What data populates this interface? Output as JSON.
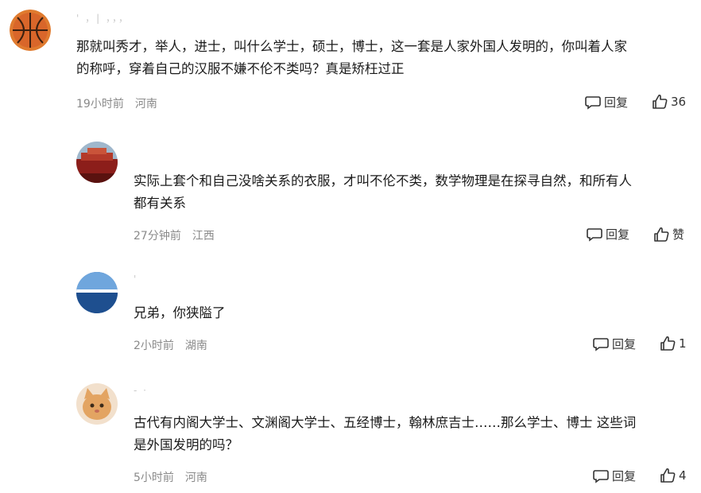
{
  "comments": [
    {
      "username": "' ，| ，，，",
      "text_lines": [
        "那就叫秀才，举人，进士，叫什么学士，硕士，博士，这一套是人家外国人发明的，你叫着人家",
        "的称呼，穿着自己的汉服不嫌不伦不类吗？真是矫枉过正"
      ],
      "time": "19小时前",
      "location": "河南",
      "reply_label": "回复",
      "like_label": "36",
      "avatar_icon": "basketball-icon"
    },
    {
      "username": "",
      "text_lines": [
        "实际上套个和自己没啥关系的衣服，才叫不伦不类，数学物理是在探寻自然，和所有人",
        "都有关系"
      ],
      "time": "27分钟前",
      "location": "江西",
      "reply_label": "回复",
      "like_label": "赞",
      "avatar_icon": "red-landscape-icon"
    },
    {
      "username": "'",
      "text_lines": [
        "兄弟，你狭隘了"
      ],
      "time": "2小时前",
      "location": "湖南",
      "reply_label": "回复",
      "like_label": "1",
      "avatar_icon": "sea-horizon-icon"
    },
    {
      "username": "- ·",
      "text_lines": [
        "古代有内阁大学士、文渊阁大学士、五经博士，翰林庶吉士……那么学士、博士 这些词",
        "是外国发明的吗？"
      ],
      "time": "5小时前",
      "location": "河南",
      "reply_label": "回复",
      "like_label": "4",
      "avatar_icon": "cat-icon"
    }
  ]
}
